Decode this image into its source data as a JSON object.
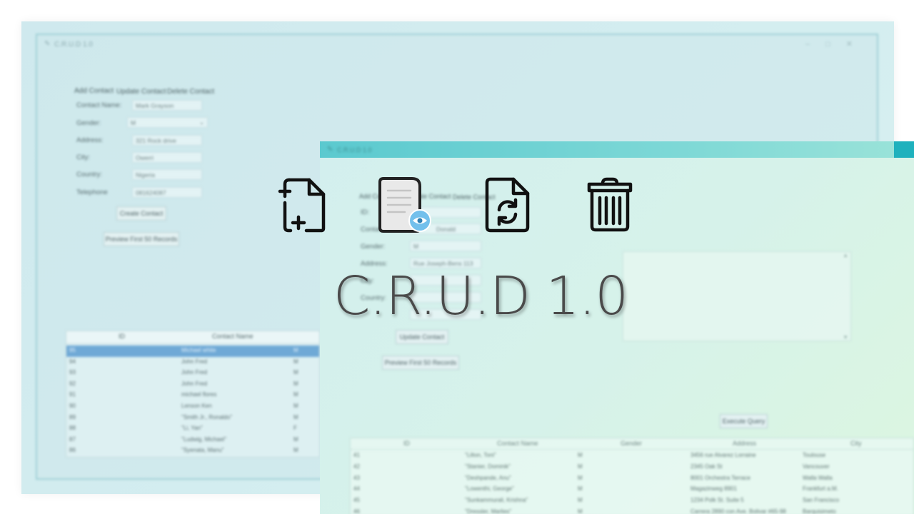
{
  "brand": {
    "title": "C.R.U.D 1.0"
  },
  "window1": {
    "title": "C.R.U.D 1.0",
    "tabs": [
      "Add Contact",
      "Update Contact",
      "Delete Contact"
    ],
    "form": {
      "contact_name_label": "Contact Name:",
      "contact_name_value": "Mark Grayson",
      "gender_label": "Gender:",
      "gender_value": "M",
      "address_label": "Address:",
      "address_value": "321 Rock drive",
      "city_label": "City:",
      "city_value": "Owerri",
      "country_label": "Country:",
      "country_value": "Nigeria",
      "telephone_label": "Telephone",
      "telephone_value": "081624087"
    },
    "create_button": "Create Contact",
    "preview_button": "Preview First 50 Records",
    "table": {
      "headers": [
        "ID",
        "Contact Name",
        ""
      ],
      "rows": [
        [
          "95",
          "Michael white",
          "M"
        ],
        [
          "94",
          "John Fred",
          "M"
        ],
        [
          "93",
          "John Fred",
          "M"
        ],
        [
          "92",
          "John Fred",
          "M"
        ],
        [
          "91",
          "michael flores",
          "M"
        ],
        [
          "90",
          "Lenson Ken",
          "M"
        ],
        [
          "89",
          "\"Smith Jr., Ronaldo\"",
          "M"
        ],
        [
          "88",
          "\"Li, Yan\"",
          "F"
        ],
        [
          "87",
          "\"Ludwig, Michael\"",
          "M"
        ],
        [
          "86",
          "\"Syenata, Manu\"",
          "M"
        ]
      ]
    }
  },
  "window2": {
    "title": "C.R.U.D 1.0",
    "tabs": [
      "Add Contact",
      "Update Contact",
      "Delete Contact"
    ],
    "form": {
      "id_label": "ID:",
      "contact_name_label": "Contact Name:",
      "contact_name_value": "Donald",
      "gender_label": "Gender:",
      "gender_value": "M",
      "address_label": "Address:",
      "address_value": "Rue Joseph-Bens 113",
      "city_label": "City:",
      "country_label": "Country:"
    },
    "update_button": "Update Contact",
    "preview_button": "Preview First 50 Records",
    "execute_button": "Execute Query",
    "table": {
      "headers": [
        "ID",
        "Contact Name",
        "Gender",
        "Address",
        "City"
      ],
      "rows": [
        [
          "41",
          "\"Lilton, Toni\"",
          "M",
          "3456 rue Alvarez Lorraine",
          "Toulouse"
        ],
        [
          "42",
          "\"Stanier, Dominik\"",
          "M",
          "2345 Oak St",
          "Vancouver"
        ],
        [
          "43",
          "\"Deshpande, Anu\"",
          "M",
          "8001 Orchestra Terrace",
          "Walla Walla"
        ],
        [
          "44",
          "\"Lowenthi, George\"",
          "M",
          "Magazinweg 8901",
          "Frankfurt a.M."
        ],
        [
          "45",
          "\"Sunkammurali, Krishna\"",
          "M",
          "1234 Polk St. Suite 5",
          "San Francisco"
        ],
        [
          "46",
          "\"Dressler, Marlies\"",
          "M",
          "Carrera 2890 con Ave. Bolivar #65-98",
          "Barquisimeto"
        ]
      ]
    }
  },
  "icons": [
    "add-file-icon",
    "view-file-icon",
    "refresh-file-icon",
    "trash-icon"
  ]
}
